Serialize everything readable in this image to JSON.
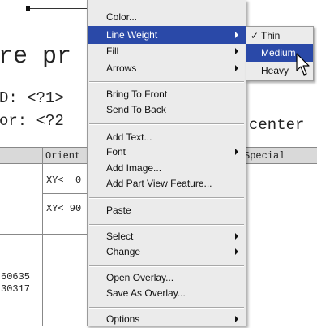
{
  "document": {
    "title_fragment": "re pr",
    "line_id": "D: <?1>",
    "line_color": "or: <?2",
    "line_center": "center",
    "table": {
      "headers": [
        "Orient",
        "Special"
      ],
      "rows": [
        {
          "orient": "XY<  0"
        },
        {
          "orient": "XY< 90"
        },
        {
          "orient": ""
        }
      ],
      "left_values": [
        "60635",
        "30317"
      ]
    }
  },
  "context_menu": {
    "items": [
      {
        "label": "Color...",
        "submenu": false
      },
      {
        "label": "Line Weight",
        "submenu": true,
        "highlighted": true
      },
      {
        "label": "Fill",
        "submenu": true
      },
      {
        "label": "Arrows",
        "submenu": true
      },
      {
        "label": "Bring To Front",
        "submenu": false
      },
      {
        "label": "Send To Back",
        "submenu": false
      },
      {
        "label": "Add Text...",
        "submenu": false
      },
      {
        "label": "Font",
        "submenu": true
      },
      {
        "label": "Add Image...",
        "submenu": false
      },
      {
        "label": "Add Part View Feature...",
        "submenu": false
      },
      {
        "label": "Paste",
        "submenu": false
      },
      {
        "label": "Select",
        "submenu": true
      },
      {
        "label": "Change",
        "submenu": true
      },
      {
        "label": "Open Overlay...",
        "submenu": false
      },
      {
        "label": "Save As Overlay...",
        "submenu": false
      },
      {
        "label": "Options",
        "submenu": true
      }
    ]
  },
  "line_weight_submenu": {
    "items": [
      {
        "label": "Thin",
        "checked": true
      },
      {
        "label": "Medium",
        "highlighted": true
      },
      {
        "label": "Heavy"
      }
    ],
    "check_glyph": "✓"
  },
  "colors": {
    "highlight": "#2a49a8",
    "menu_bg": "#ebebeb",
    "table_header": "#d9d9d9"
  }
}
